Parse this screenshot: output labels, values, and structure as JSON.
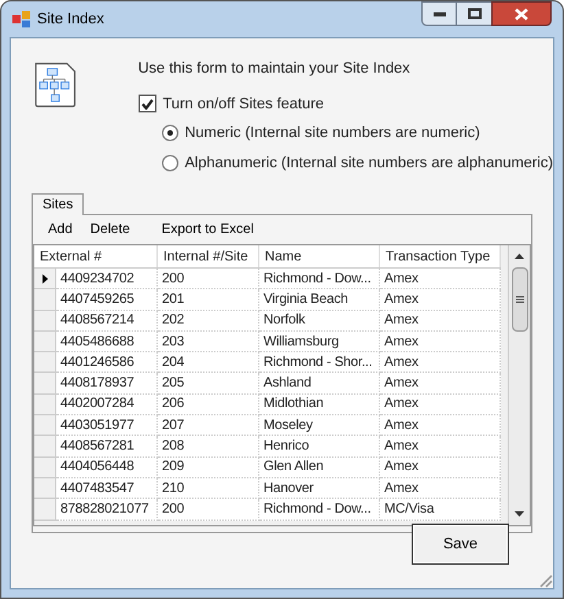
{
  "window": {
    "title": "Site Index"
  },
  "intro": "Use this form to maintain your Site Index",
  "feature_checkbox": {
    "label": "Turn on/off Sites feature",
    "checked": true
  },
  "radios": [
    {
      "label": "Numeric (Internal site numbers are numeric)",
      "selected": true
    },
    {
      "label": "Alphanumeric (Internal site numbers are alphanumeric)",
      "selected": false
    }
  ],
  "tabs": [
    {
      "label": "Sites",
      "selected": true
    }
  ],
  "toolbar": [
    "Add",
    "Delete",
    "Export to Excel"
  ],
  "table": {
    "columns": [
      "External #",
      "Internal #/Site",
      "Name",
      "Transaction Type"
    ],
    "rows": [
      {
        "cells": [
          "4409234702",
          "200",
          "Richmond - Dow...",
          "Amex"
        ],
        "selected": true
      },
      {
        "cells": [
          "4407459265",
          "201",
          "Virginia Beach",
          "Amex"
        ],
        "selected": false
      },
      {
        "cells": [
          "4408567214",
          "202",
          "Norfolk",
          "Amex"
        ],
        "selected": false
      },
      {
        "cells": [
          "4405486688",
          "203",
          "Williamsburg",
          "Amex"
        ],
        "selected": false
      },
      {
        "cells": [
          "4401246586",
          "204",
          "Richmond - Shor...",
          "Amex"
        ],
        "selected": false
      },
      {
        "cells": [
          "4408178937",
          "205",
          "Ashland",
          "Amex"
        ],
        "selected": false
      },
      {
        "cells": [
          "4402007284",
          "206",
          "Midlothian",
          "Amex"
        ],
        "selected": false
      },
      {
        "cells": [
          "4403051977",
          "207",
          "Moseley",
          "Amex"
        ],
        "selected": false
      },
      {
        "cells": [
          "4408567281",
          "208",
          "Henrico",
          "Amex"
        ],
        "selected": false
      },
      {
        "cells": [
          "4404056448",
          "209",
          "Glen Allen",
          "Amex"
        ],
        "selected": false
      },
      {
        "cells": [
          "4407483547",
          "210",
          "Hanover",
          "Amex"
        ],
        "selected": false
      },
      {
        "cells": [
          "878828021077",
          "200",
          "Richmond - Dow...",
          "MC/Visa"
        ],
        "selected": false
      }
    ]
  },
  "save_button": "Save"
}
